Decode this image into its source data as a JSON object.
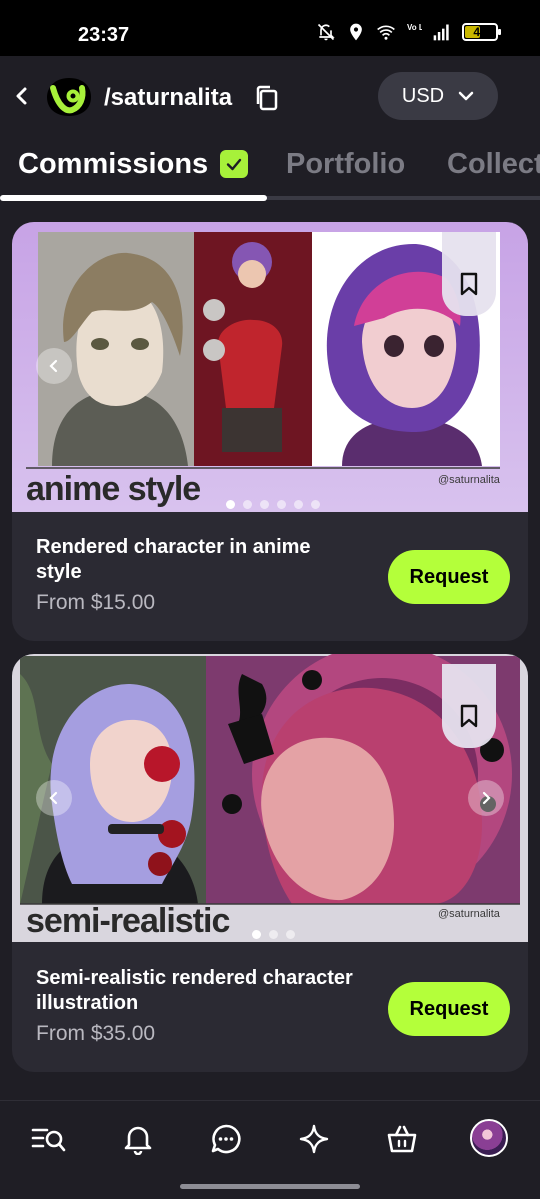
{
  "status_bar": {
    "time": "23:37",
    "battery": "49",
    "battery_level": 0.49,
    "network_label": "Vo LTE",
    "icons": [
      "mute-icon",
      "location-icon",
      "wifi-icon",
      "volte-icon",
      "signal-icon",
      "battery-icon"
    ]
  },
  "header": {
    "handle": "/saturnalita",
    "currency": "USD"
  },
  "tabs": [
    {
      "label": "Commissions",
      "active": true,
      "verified": true
    },
    {
      "label": "Portfolio",
      "active": false
    },
    {
      "label": "Collect",
      "active": false
    }
  ],
  "commissions": [
    {
      "title": "Rendered character in anime style",
      "price": "From $15.00",
      "button": "Request",
      "image_caption": "anime style",
      "image_credit": "@saturnalita",
      "slide_count": 6,
      "active_slide": 1
    },
    {
      "title": "Semi-realistic rendered character illustration",
      "price": "From $35.00",
      "button": "Request",
      "image_caption": "semi-realistic",
      "image_credit": "@saturnalita",
      "slide_count": 3,
      "active_slide": 1
    }
  ],
  "bottom_nav": [
    "search-list-icon",
    "bell-icon",
    "chat-icon",
    "sparkle-icon",
    "basket-icon",
    "avatar"
  ],
  "colors": {
    "accent": "#b4ff3a",
    "background": "#1f1e25",
    "card": "#2b2a33",
    "muted_text": "#7b7b84"
  }
}
